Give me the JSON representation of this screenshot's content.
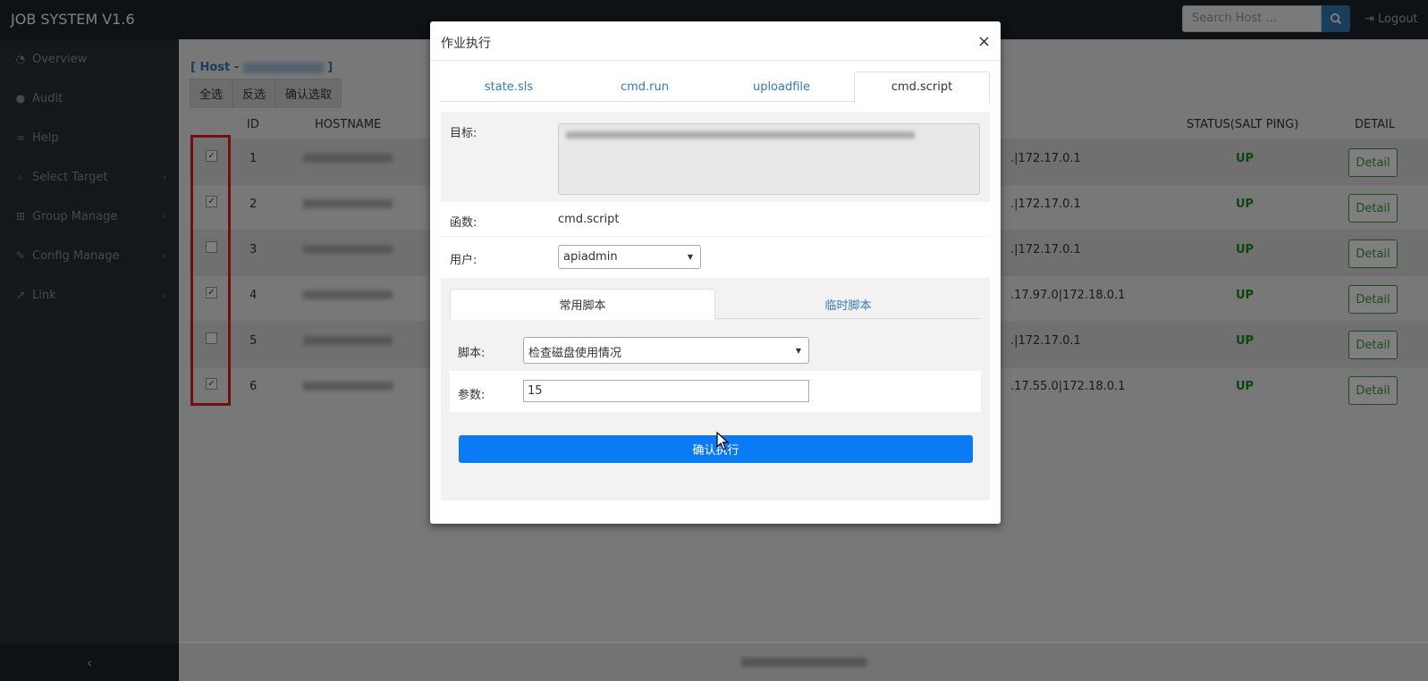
{
  "topbar": {
    "brand": "JOB SYSTEM V1.6",
    "search_placeholder": "Search Host ...",
    "logout": "Logout"
  },
  "sidebar": {
    "items": [
      {
        "label": "Overview",
        "icon": "dashboard-icon"
      },
      {
        "label": "Audit",
        "icon": "user-icon"
      },
      {
        "label": "Help",
        "icon": "link-icon"
      },
      {
        "label": "Select Target",
        "icon": "search-icon"
      },
      {
        "label": "Group Manage",
        "icon": "sitemap-icon"
      },
      {
        "label": "Config Manage",
        "icon": "wrench-icon"
      },
      {
        "label": "Link",
        "icon": "external-link-icon"
      }
    ],
    "collapse": "‹"
  },
  "main": {
    "crumb_prefix": "[ Host - ",
    "crumb_suffix": " ]",
    "buttons": {
      "select_all": "全选",
      "invert": "反选",
      "confirm": "确认选取"
    },
    "headers": {
      "id": "ID",
      "hostname": "HOSTNAME",
      "status": "STATUS(SALT PING)",
      "detail": "DETAIL"
    },
    "rows": [
      {
        "id": "1",
        "checked": true,
        "ip": ".|172.17.0.1",
        "status": "UP",
        "detail": "Detail"
      },
      {
        "id": "2",
        "checked": true,
        "ip": ".|172.17.0.1",
        "status": "UP",
        "detail": "Detail"
      },
      {
        "id": "3",
        "checked": false,
        "ip": ".|172.17.0.1",
        "status": "UP",
        "detail": "Detail"
      },
      {
        "id": "4",
        "checked": true,
        "ip": ".17.97.0|172.18.0.1",
        "status": "UP",
        "detail": "Detail"
      },
      {
        "id": "5",
        "checked": false,
        "ip": ".|172.17.0.1",
        "status": "UP",
        "detail": "Detail"
      },
      {
        "id": "6",
        "checked": true,
        "ip": ".17.55.0|172.18.0.1",
        "status": "UP",
        "detail": "Detail"
      }
    ]
  },
  "modal": {
    "title": "作业执行",
    "close": "×",
    "tabs": [
      "state.sls",
      "cmd.run",
      "uploadfile",
      "cmd.script"
    ],
    "active_tab": "cmd.script",
    "target_label": "目标:",
    "function_label": "函数:",
    "function_value": "cmd.script",
    "user_label": "用户:",
    "user_value": "apiadmin",
    "subtabs": [
      "常用脚本",
      "临时脚本"
    ],
    "active_subtab": "常用脚本",
    "script_label": "脚本:",
    "script_value": "检查磁盘使用情况",
    "args_label": "参数:",
    "args_value": "15",
    "execute": "确认执行"
  },
  "colors": {
    "primary": "#0a7bf5",
    "success": "#3b9a3b",
    "highlight": "#e02020"
  }
}
